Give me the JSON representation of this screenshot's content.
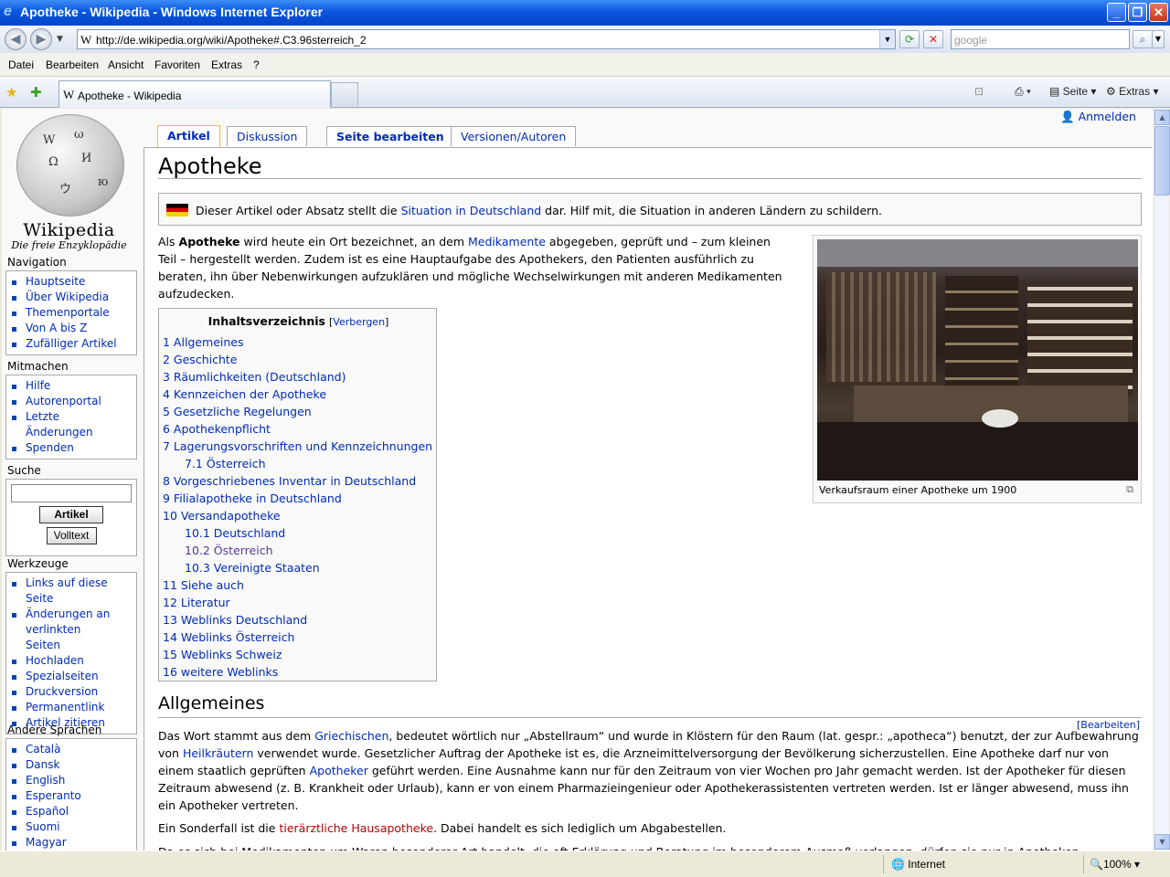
{
  "window": {
    "title": "Apotheke - Wikipedia - Windows Internet Explorer"
  },
  "address": {
    "url": "http://de.wikipedia.org/wiki/Apotheke#.C3.96sterreich_2",
    "search_placeholder": "google"
  },
  "menu": [
    "Datei",
    "Bearbeiten",
    "Ansicht",
    "Favoriten",
    "Extras",
    "?"
  ],
  "browser_tab": {
    "label": "Apotheke - Wikipedia"
  },
  "commandbar": {
    "page": "Seite",
    "tools": "Extras"
  },
  "logo": {
    "name": "Wikipedia",
    "tagline": "Die freie Enzyklopädie"
  },
  "sidebar": {
    "navigation": {
      "title": "Navigation",
      "items": [
        "Hauptseite",
        "Über Wikipedia",
        "Themenportale",
        "Von A bis Z",
        "Zufälliger Artikel"
      ]
    },
    "mitmachen": {
      "title": "Mitmachen",
      "items": [
        "Hilfe",
        "Autorenportal",
        "Letzte Änderungen",
        "Spenden"
      ]
    },
    "suche": {
      "title": "Suche",
      "button_article": "Artikel",
      "button_fulltext": "Volltext"
    },
    "werkzeuge": {
      "title": "Werkzeuge",
      "items": [
        "Links auf diese Seite",
        "Änderungen an verlinkten Seiten",
        "Hochladen",
        "Spezialseiten",
        "Druckversion",
        "Permanentlink",
        "Artikel zitieren"
      ]
    },
    "sprachen": {
      "title": "Andere Sprachen",
      "items": [
        "Català",
        "Dansk",
        "English",
        "Esperanto",
        "Español",
        "Suomi",
        "Magyar"
      ]
    }
  },
  "page_tabs": {
    "article": "Artikel",
    "discussion": "Diskussion",
    "edit": "Seite bearbeiten",
    "history": "Versionen/Autoren"
  },
  "login": "Anmelden",
  "article": {
    "title": "Apotheke",
    "notice": {
      "pre": "Dieser Artikel oder Absatz stellt die ",
      "link": "Situation in Deutschland",
      "post": " dar. Hilf mit, die Situation in anderen Ländern zu schildern."
    },
    "intro": {
      "p1": "Als ",
      "bold": "Apotheke",
      "p2": " wird heute ein Ort bezeichnet, an dem ",
      "link": "Medikamente",
      "p3": " abgegeben, geprüft und – zum kleinen Teil – hergestellt werden. Zudem ist es eine Hauptaufgabe des Apothekers, den Patienten ausführlich zu beraten, ihn über Nebenwirkungen aufzuklären und mögliche Wechselwirkungen mit anderen Medikamenten aufzudecken."
    },
    "thumb_caption": "Verkaufsraum einer Apotheke um 1900",
    "toc": {
      "title": "Inhaltsverzeichnis",
      "hide_pre": "[",
      "hide": "Verbergen",
      "hide_post": "]",
      "items": [
        {
          "t": "1 Allgemeines",
          "lvl": 1
        },
        {
          "t": "2 Geschichte",
          "lvl": 1
        },
        {
          "t": "3 Räumlichkeiten (Deutschland)",
          "lvl": 1
        },
        {
          "t": "4 Kennzeichen der Apotheke",
          "lvl": 1
        },
        {
          "t": "5 Gesetzliche Regelungen",
          "lvl": 1
        },
        {
          "t": "6 Apothekenpflicht",
          "lvl": 1
        },
        {
          "t": "7 Lagerungsvorschriften und Kennzeichnungen",
          "lvl": 1
        },
        {
          "t": "7.1 Österreich",
          "lvl": 2
        },
        {
          "t": "8 Vorgeschriebenes Inventar in Deutschland",
          "lvl": 1
        },
        {
          "t": "9 Filialapotheke in Deutschland",
          "lvl": 1
        },
        {
          "t": "10 Versandapotheke",
          "lvl": 1
        },
        {
          "t": "10.1 Deutschland",
          "lvl": 2
        },
        {
          "t": "10.2 Österreich",
          "lvl": 2
        },
        {
          "t": "10.3 Vereinigte Staaten",
          "lvl": 2
        },
        {
          "t": "11 Siehe auch",
          "lvl": 1
        },
        {
          "t": "12 Literatur",
          "lvl": 1
        },
        {
          "t": "13 Weblinks Deutschland",
          "lvl": 1
        },
        {
          "t": "14 Weblinks Österreich",
          "lvl": 1
        },
        {
          "t": "15 Weblinks Schweiz",
          "lvl": 1
        },
        {
          "t": "16 weitere Weblinks",
          "lvl": 1
        }
      ]
    },
    "section1": {
      "title": "Allgemeines",
      "edit": "[Bearbeiten]"
    },
    "para1": {
      "a": "Das Wort stammt aus dem ",
      "l1": "Griechischen",
      "b": ", bedeutet wörtlich nur „Abstellraum“ und wurde in Klöstern für den Raum (lat. gespr.: „apotheca“) benutzt, der zur Aufbewahrung von ",
      "l2": "Heilkräutern",
      "c": " verwendet wurde. Gesetzlicher Auftrag der Apotheke ist es, die Arzneimittelversorgung der Bevölkerung sicherzustellen. Eine Apotheke darf nur von einem staatlich geprüften ",
      "l3": "Apotheker",
      "d": " geführt werden. Eine Ausnahme kann nur für den Zeitraum von vier Wochen pro Jahr gemacht werden. Ist der Apotheker für diesen Zeitraum abwesend (z. B. Krankheit oder Urlaub), kann er von einem Pharmazieingenieur oder Apothekerassistenten vertreten werden. Ist er länger abwesend, muss ihn ein Apotheker vertreten."
    },
    "para2": {
      "a": "Ein Sonderfall ist die ",
      "l": "tierärztliche Hausapotheke",
      "b": ". Dabei handelt es sich lediglich um Abgabestellen."
    },
    "para3": "Da es sich bei Medikamenten um Waren besonderer Art handelt, die oft Erklärung und Beratung im besonderem Ausmaß verlangen, dürfen sie nur in Apotheken"
  },
  "status": {
    "zone": "Internet",
    "zoom": "100%"
  }
}
